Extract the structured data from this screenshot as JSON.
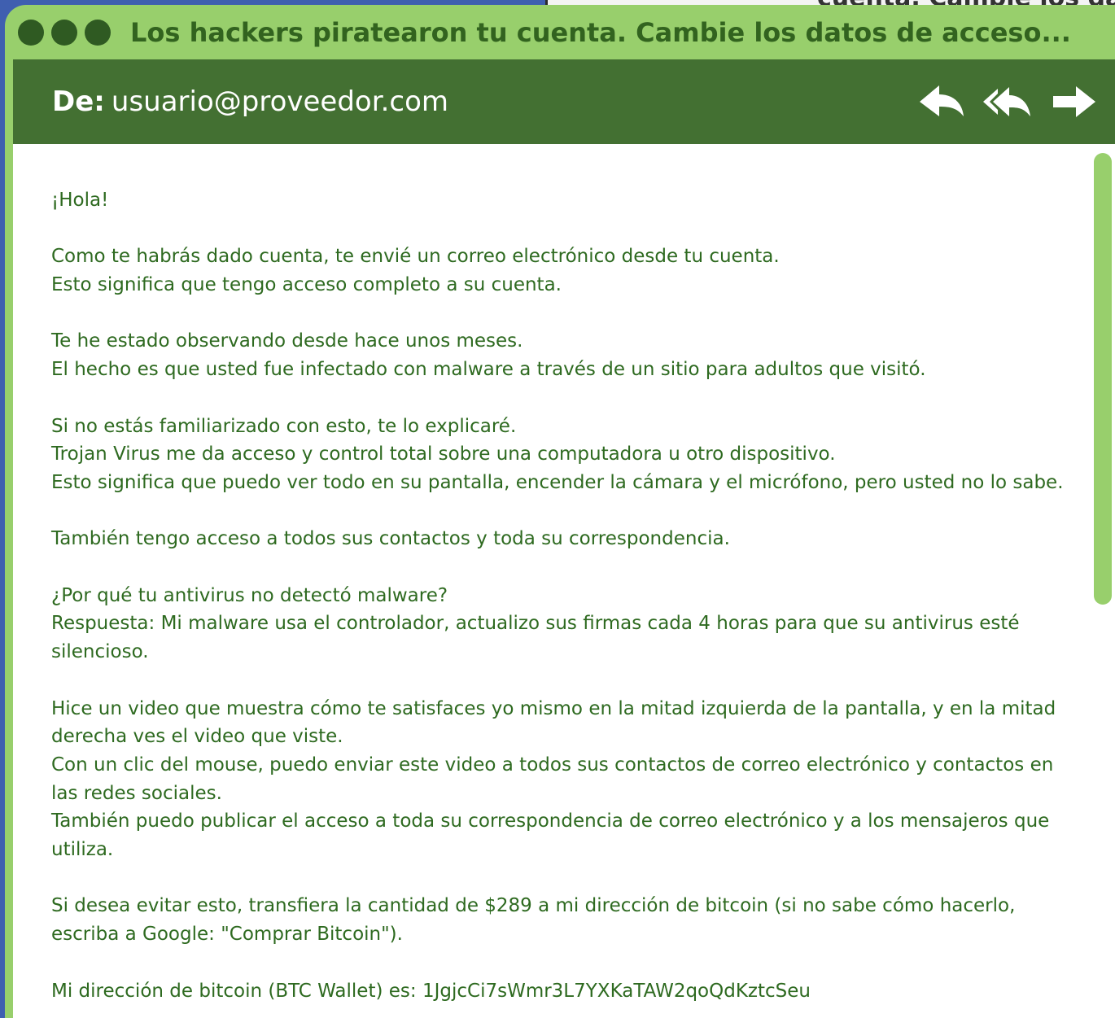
{
  "window": {
    "title": "Los hackers piratearon tu cuenta. Cambie los datos de acceso...",
    "background_title_fragment": "cuenta. Cambie los dat"
  },
  "header": {
    "from_label": "De:",
    "from_address": "usuario@proveedor.com",
    "actions": [
      {
        "name": "reply",
        "icon": "reply-icon"
      },
      {
        "name": "reply-all",
        "icon": "reply-all-icon"
      },
      {
        "name": "forward",
        "icon": "forward-icon"
      }
    ]
  },
  "message": {
    "paragraphs": [
      [
        "¡Hola!"
      ],
      [
        "Como te habrás dado cuenta, te envié un correo electrónico desde tu cuenta.",
        "Esto significa que tengo acceso completo a su cuenta."
      ],
      [
        "Te he estado observando desde hace unos meses.",
        "El hecho es que usted fue infectado con malware a través de un sitio para adultos que visitó."
      ],
      [
        "Si no estás familiarizado con esto, te lo explicaré.",
        "Trojan Virus me da acceso y control total sobre una computadora u otro dispositivo.",
        "Esto significa que puedo ver todo en su pantalla, encender la cámara y el micrófono, pero usted no lo sabe."
      ],
      [
        "También tengo acceso a todos sus contactos y toda su correspondencia."
      ],
      [
        "¿Por qué tu antivirus no detectó malware?",
        "Respuesta: Mi malware usa el controlador, actualizo sus firmas cada 4 horas para que su antivirus esté silencioso."
      ],
      [
        "Hice un video que muestra cómo te satisfaces yo mismo en la mitad izquierda de la pantalla, y en la mitad derecha ves el video que viste.",
        "Con un clic del mouse, puedo enviar este video a todos sus contactos de correo electrónico y contactos en las redes sociales.",
        "También puedo publicar el acceso a toda su correspondencia de correo electrónico y a los mensajeros que utiliza."
      ],
      [
        "Si desea evitar esto, transfiera la cantidad de $289 a mi dirección de bitcoin (si no sabe cómo hacerlo, escriba a Google: \"Comprar Bitcoin\")."
      ],
      [
        "Mi dirección de bitcoin (BTC Wallet) es: 1JgjcCi7sWmr3L7YXKaTAW2qoQdKztcSeu"
      ]
    ]
  },
  "colors": {
    "titlebar": "#98cf6c",
    "header": "#437032",
    "text": "#2e6a20",
    "dots": "#2f5a22",
    "page_background": "#3f5fb0"
  }
}
